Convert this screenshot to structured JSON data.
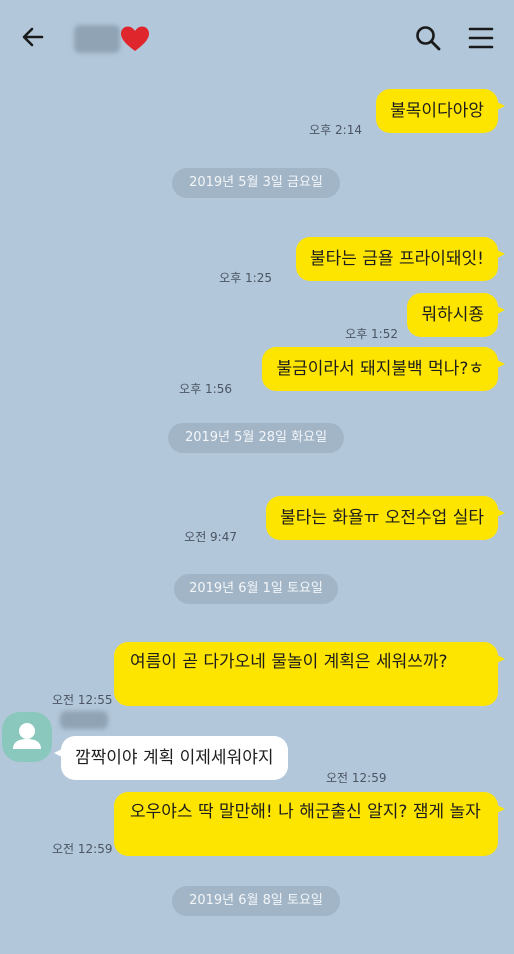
{
  "header": {
    "back_icon": "back-arrow-icon",
    "heart_icon": "red-heart-emoji",
    "search_icon": "search-icon",
    "menu_icon": "hamburger-menu-icon"
  },
  "messages": [
    {
      "text": "불목이다아앙",
      "time": "오후 2:14"
    },
    {
      "date": "2019년 5월 3일 금요일"
    },
    {
      "text": "불타는 금욜 프라이돼잇!",
      "time": "오후 1:25"
    },
    {
      "text": "뭐하시죵",
      "time": "오후 1:52"
    },
    {
      "text": "불금이라서 돼지불백 먹나?ㅎ",
      "time": "오후 1:56"
    },
    {
      "date": "2019년 5월 28일 화요일"
    },
    {
      "text": "불타는 화욜ㅠ 오전수업 실타",
      "time": "오전 9:47"
    },
    {
      "date": "2019년 6월 1일 토요일"
    },
    {
      "text": "여름이 곧 다가오네 물놀이 계획은 세워쓰까?",
      "time": "오전 12:55"
    },
    {
      "text": "깜짝이야 계획 이제세워야지",
      "time": "오전 12:59"
    },
    {
      "text": "오우야스 딱 말만해! 나 해군출신 알지? 잼게 놀자",
      "time": "오전 12:59"
    },
    {
      "date": "2019년 6월 8일 토요일"
    }
  ],
  "colors": {
    "background": "#b2c7da",
    "my_bubble": "#fee500",
    "their_bubble": "#ffffff",
    "date_pill": "#a2b5c6"
  }
}
